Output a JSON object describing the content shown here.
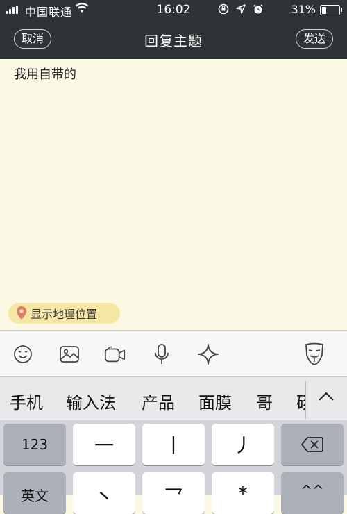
{
  "status_bar": {
    "carrier": "中国联通",
    "time": "16:02",
    "battery_percent": "31%",
    "battery_level": 0.31
  },
  "nav": {
    "cancel_label": "取消",
    "title": "回复主题",
    "send_label": "发送"
  },
  "compose": {
    "text": "我用自带的"
  },
  "location": {
    "label": "显示地理位置"
  },
  "toolbar": {
    "icons": [
      "smiley-icon",
      "image-icon",
      "video-icon",
      "microphone-icon",
      "sparkle-icon",
      "mask-icon"
    ]
  },
  "keyboard": {
    "candidates": [
      "手机",
      "输入法",
      "产品",
      "面膜",
      "哥",
      "砀"
    ],
    "row1": {
      "num": "123",
      "k1": "一",
      "k2": "丨",
      "k3": "丿"
    },
    "row2": {
      "lang": "英文",
      "k1": "丶",
      "k2": "乛",
      "k3": "*",
      "k4": "^^"
    }
  },
  "colors": {
    "header_bg": "#2e3436",
    "compose_bg": "#fbf8e4",
    "chip_bg": "#f7e7a5",
    "keyboard_bg": "#d2d4d9"
  }
}
